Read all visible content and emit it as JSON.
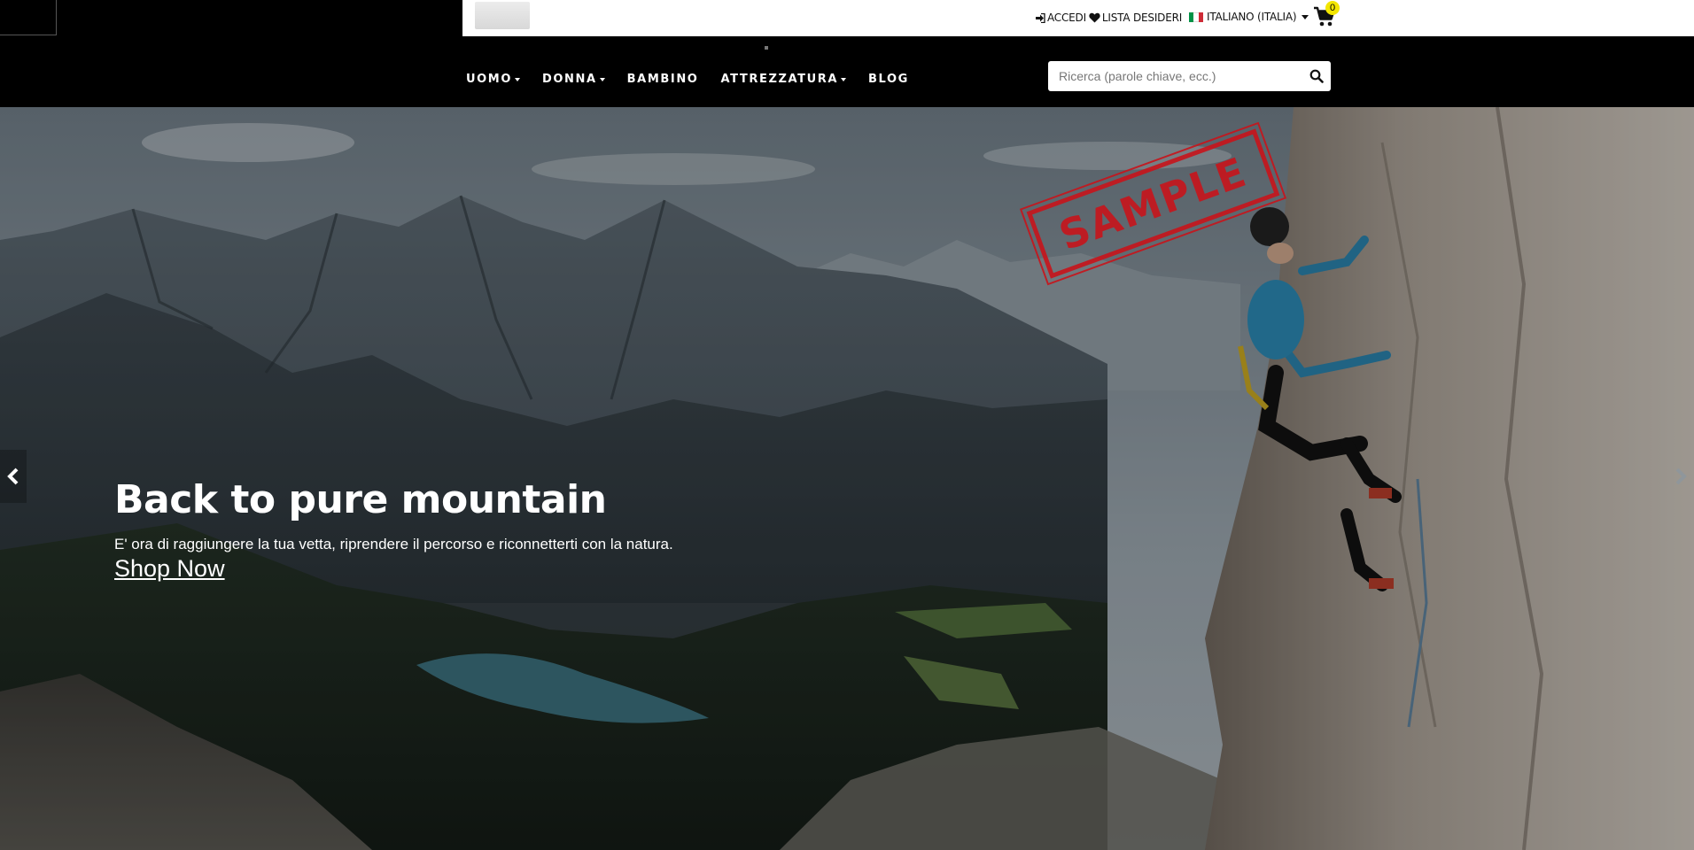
{
  "header": {
    "login_label": "ACCEDI",
    "wishlist_label": "LISTA DESIDERI",
    "language_label": "ITALIANO (ITALIA)",
    "cart_count": "0"
  },
  "nav": {
    "items": [
      {
        "label": "UOMO",
        "has_dropdown": true
      },
      {
        "label": "DONNA",
        "has_dropdown": true
      },
      {
        "label": "BAMBINO",
        "has_dropdown": false
      },
      {
        "label": "ATTREZZATURA",
        "has_dropdown": true
      },
      {
        "label": "BLOG",
        "has_dropdown": false
      }
    ]
  },
  "search": {
    "placeholder": "Ricerca (parole chiave, ecc.)",
    "value": ""
  },
  "hero": {
    "title": "Back to pure mountain",
    "subtitle": "E' ora di raggiungere la tua vetta, riprendere il percorso e riconnetterti con la natura.",
    "cta": "Shop Now",
    "stamp": "SAMPLE"
  },
  "icons": {
    "login": "sign-in-icon",
    "wishlist": "heart-icon",
    "flag": "italy-flag-icon",
    "cart": "shopping-cart-icon",
    "search": "search-icon",
    "prev": "chevron-left-icon",
    "next": "chevron-right-icon"
  },
  "colors": {
    "nav_bg": "#000000",
    "topbar_bg": "#ffffff",
    "cart_badge": "#f3e600",
    "stamp_red": "#c8141b",
    "flag_green": "#009246",
    "flag_white": "#ffffff",
    "flag_red": "#ce2b37"
  }
}
